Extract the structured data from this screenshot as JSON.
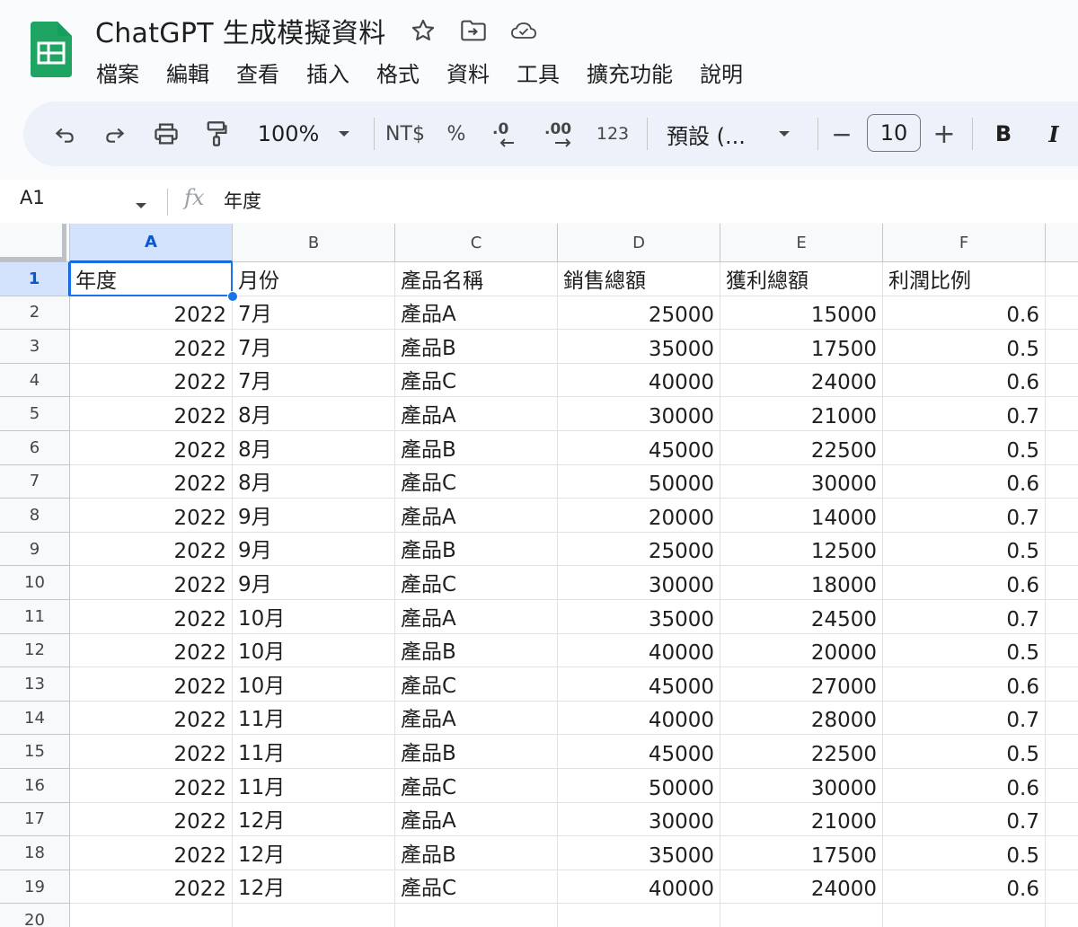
{
  "app": {
    "doc_title": "ChatGPT 生成模擬資料",
    "title_icons": [
      "star-icon",
      "move-to-folder-icon",
      "cloud-saved-icon"
    ],
    "menu": [
      "檔案",
      "編輯",
      "查看",
      "插入",
      "格式",
      "資料",
      "工具",
      "擴充功能",
      "說明"
    ]
  },
  "toolbar": {
    "zoom": "100%",
    "currency": "NT$",
    "percent": "%",
    "decimal_decrease": ".0",
    "decimal_increase": ".00",
    "number_format": "123",
    "font_name": "預設 (...",
    "font_size": "10",
    "minus": "−",
    "plus": "+",
    "bold": "B",
    "italic": "I"
  },
  "formula_bar": {
    "cell_ref": "A1",
    "fx": "fx",
    "content": "年度"
  },
  "sheet": {
    "columns": [
      "A",
      "B",
      "C",
      "D",
      "E",
      "F"
    ],
    "row_numbers": [
      "1",
      "2",
      "3",
      "4",
      "5",
      "6",
      "7",
      "8",
      "9",
      "10",
      "11",
      "12",
      "13",
      "14",
      "15",
      "16",
      "17",
      "18",
      "19",
      "20"
    ],
    "selected_cell": "A1",
    "rows": [
      [
        "年度",
        "月份",
        "產品名稱",
        "銷售總額",
        "獲利總額",
        "利潤比例"
      ],
      [
        "2022",
        "7月",
        "產品A",
        "25000",
        "15000",
        "0.6"
      ],
      [
        "2022",
        "7月",
        "產品B",
        "35000",
        "17500",
        "0.5"
      ],
      [
        "2022",
        "7月",
        "產品C",
        "40000",
        "24000",
        "0.6"
      ],
      [
        "2022",
        "8月",
        "產品A",
        "30000",
        "21000",
        "0.7"
      ],
      [
        "2022",
        "8月",
        "產品B",
        "45000",
        "22500",
        "0.5"
      ],
      [
        "2022",
        "8月",
        "產品C",
        "50000",
        "30000",
        "0.6"
      ],
      [
        "2022",
        "9月",
        "產品A",
        "20000",
        "14000",
        "0.7"
      ],
      [
        "2022",
        "9月",
        "產品B",
        "25000",
        "12500",
        "0.5"
      ],
      [
        "2022",
        "9月",
        "產品C",
        "30000",
        "18000",
        "0.6"
      ],
      [
        "2022",
        "10月",
        "產品A",
        "35000",
        "24500",
        "0.7"
      ],
      [
        "2022",
        "10月",
        "產品B",
        "40000",
        "20000",
        "0.5"
      ],
      [
        "2022",
        "10月",
        "產品C",
        "45000",
        "27000",
        "0.6"
      ],
      [
        "2022",
        "11月",
        "產品A",
        "40000",
        "28000",
        "0.7"
      ],
      [
        "2022",
        "11月",
        "產品B",
        "45000",
        "22500",
        "0.5"
      ],
      [
        "2022",
        "11月",
        "產品C",
        "50000",
        "30000",
        "0.6"
      ],
      [
        "2022",
        "12月",
        "產品A",
        "30000",
        "21000",
        "0.7"
      ],
      [
        "2022",
        "12月",
        "產品B",
        "35000",
        "17500",
        "0.5"
      ],
      [
        "2022",
        "12月",
        "產品C",
        "40000",
        "24000",
        "0.6"
      ],
      [
        "",
        "",
        "",
        "",
        "",
        ""
      ]
    ]
  }
}
